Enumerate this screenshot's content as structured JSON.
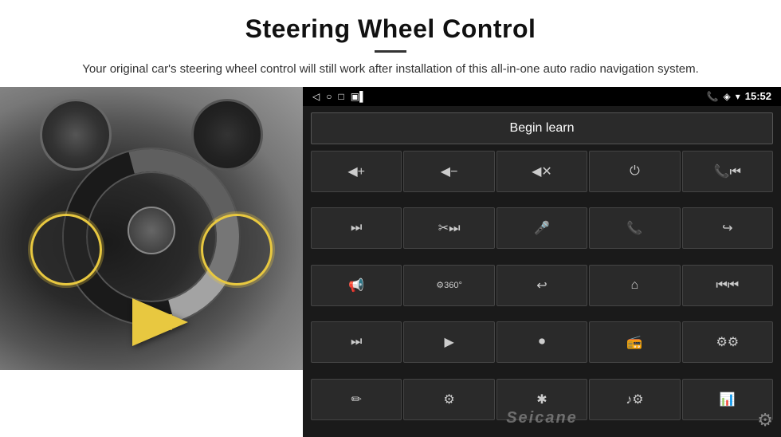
{
  "header": {
    "title": "Steering Wheel Control",
    "subtitle": "Your original car's steering wheel control will still work after installation of this all-in-one auto radio navigation system."
  },
  "status_bar": {
    "time": "15:52",
    "icons": [
      "◁",
      "○",
      "□",
      "📱"
    ]
  },
  "begin_learn_btn": "Begin learn",
  "controls": [
    {
      "icon": "🔊+",
      "label": "vol-up"
    },
    {
      "icon": "🔊−",
      "label": "vol-down"
    },
    {
      "icon": "🔇",
      "label": "mute"
    },
    {
      "icon": "⏻",
      "label": "power"
    },
    {
      "icon": "⏮",
      "label": "prev-track-phone"
    },
    {
      "icon": "⏭",
      "label": "next"
    },
    {
      "icon": "✂⏭",
      "label": "ff"
    },
    {
      "icon": "🎤",
      "label": "mic"
    },
    {
      "icon": "📞",
      "label": "call"
    },
    {
      "icon": "↩",
      "label": "hangup"
    },
    {
      "icon": "📢",
      "label": "horn"
    },
    {
      "icon": "360°",
      "label": "camera-360"
    },
    {
      "icon": "↩",
      "label": "back"
    },
    {
      "icon": "🏠",
      "label": "home"
    },
    {
      "icon": "⏮⏮",
      "label": "prev"
    },
    {
      "icon": "⏭",
      "label": "next2"
    },
    {
      "icon": "▶",
      "label": "navigate"
    },
    {
      "icon": "⏺",
      "label": "source"
    },
    {
      "icon": "📻",
      "label": "radio"
    },
    {
      "icon": "⚙️",
      "label": "settings"
    },
    {
      "icon": "✏",
      "label": "edit"
    },
    {
      "icon": "⚙",
      "label": "settings2"
    },
    {
      "icon": "✱",
      "label": "bluetooth"
    },
    {
      "icon": "♪",
      "label": "music"
    },
    {
      "icon": "📊",
      "label": "equalizer"
    }
  ],
  "watermark": "Seicane",
  "gear_icon": "⚙"
}
